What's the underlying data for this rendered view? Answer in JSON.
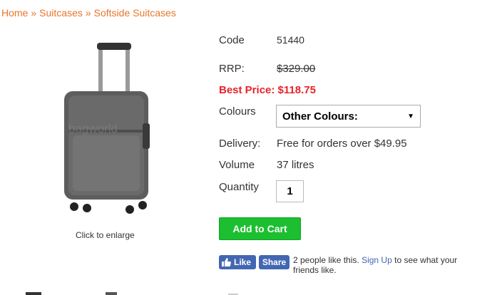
{
  "breadcrumb": {
    "items": [
      "Home",
      "Suitcases",
      "Softside Suitcases"
    ],
    "separator": "»"
  },
  "image": {
    "enlarge_text": "Click to enlarge",
    "watermark": "bagworld"
  },
  "details": {
    "code_label": "Code",
    "code_value": "51440",
    "rrp_label": "RRP:",
    "rrp_value": "$329.00",
    "best_label": "Best Price:",
    "best_value": "$118.75",
    "colours_label": "Colours",
    "colours_selected": "Other Colours:",
    "delivery_label": "Delivery:",
    "delivery_value": "Free for orders over $49.95",
    "volume_label": "Volume",
    "volume_value": "37 litres",
    "quantity_label": "Quantity",
    "quantity_value": "1"
  },
  "cart": {
    "add_label": "Add to Cart"
  },
  "facebook": {
    "like_label": "Like",
    "share_label": "Share",
    "count_text": "2 people like this.",
    "signup_link": "Sign Up",
    "tail_text": "to see what your friends like."
  },
  "colors": {
    "link": "#e8762b",
    "best_price": "#e8222a",
    "cart_button": "#1bbf2f",
    "facebook": "#4267b2"
  }
}
